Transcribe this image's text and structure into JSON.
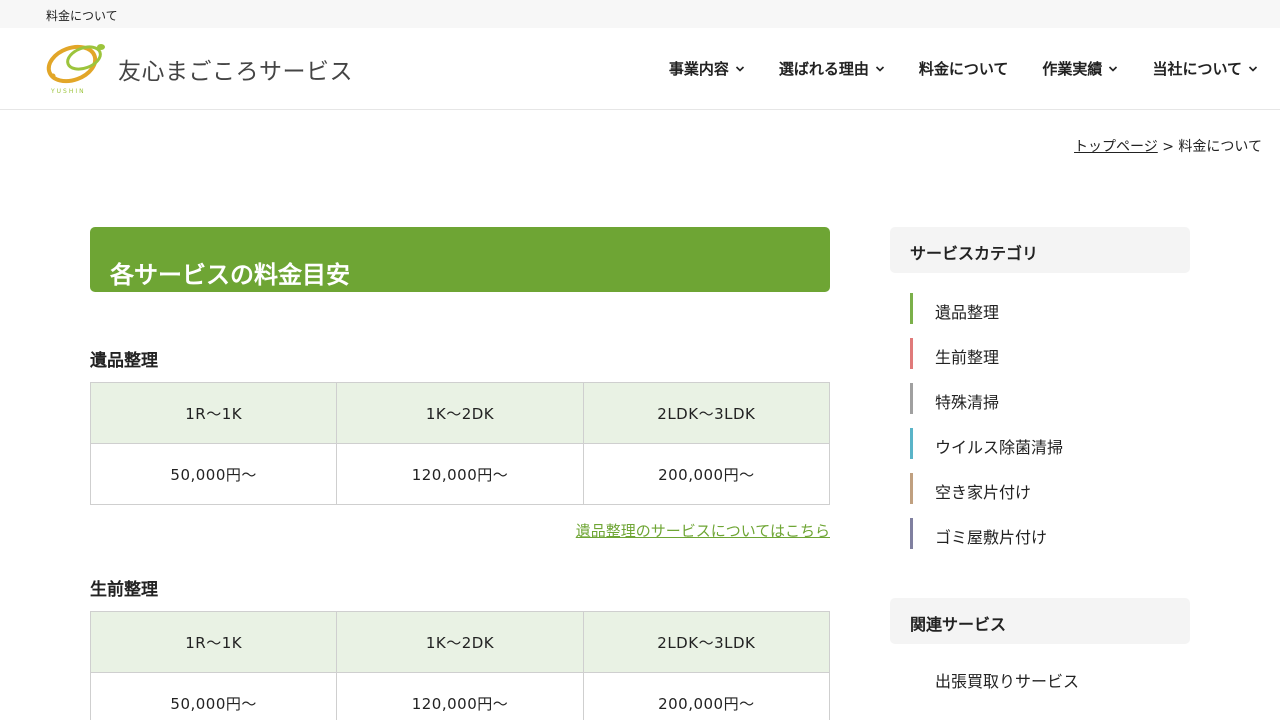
{
  "topbar": {
    "text": "料金について"
  },
  "header": {
    "logo_text": "友心まごころサービス",
    "logo_sub": "YUSHIN",
    "nav": [
      {
        "label": "事業内容",
        "has_dropdown": true
      },
      {
        "label": "選ばれる理由",
        "has_dropdown": true
      },
      {
        "label": "料金について",
        "has_dropdown": false
      },
      {
        "label": "作業実績",
        "has_dropdown": true
      },
      {
        "label": "当社について",
        "has_dropdown": true
      }
    ]
  },
  "breadcrumb": {
    "home": "トップページ",
    "separator": ">",
    "current": "料金について"
  },
  "main": {
    "title": "各サービスの料金目安",
    "sections": [
      {
        "title": "遺品整理",
        "headers": [
          "1R〜1K",
          "1K〜2DK",
          "2LDK〜3LDK"
        ],
        "prices": [
          "50,000円〜",
          "120,000円〜",
          "200,000円〜"
        ],
        "link": "遺品整理のサービスについてはこちら"
      },
      {
        "title": "生前整理",
        "headers": [
          "1R〜1K",
          "1K〜2DK",
          "2LDK〜3LDK"
        ],
        "prices": [
          "50,000円〜",
          "120,000円〜",
          "200,000円〜"
        ]
      }
    ]
  },
  "sidebar": {
    "category_title": "サービスカテゴリ",
    "categories": [
      {
        "label": "遺品整理",
        "color": "#7bb04a"
      },
      {
        "label": "生前整理",
        "color": "#e07a7a"
      },
      {
        "label": "特殊清掃",
        "color": "#a0a0a0"
      },
      {
        "label": "ウイルス除菌清掃",
        "color": "#5ab4c8"
      },
      {
        "label": "空き家片付け",
        "color": "#c0a080"
      },
      {
        "label": "ゴミ屋敷片付け",
        "color": "#8080a0"
      }
    ],
    "related_title": "関連サービス",
    "related": [
      "出張買取りサービス"
    ]
  },
  "colors": {
    "accent": "#6ea534",
    "table_head": "#e9f2e4"
  }
}
